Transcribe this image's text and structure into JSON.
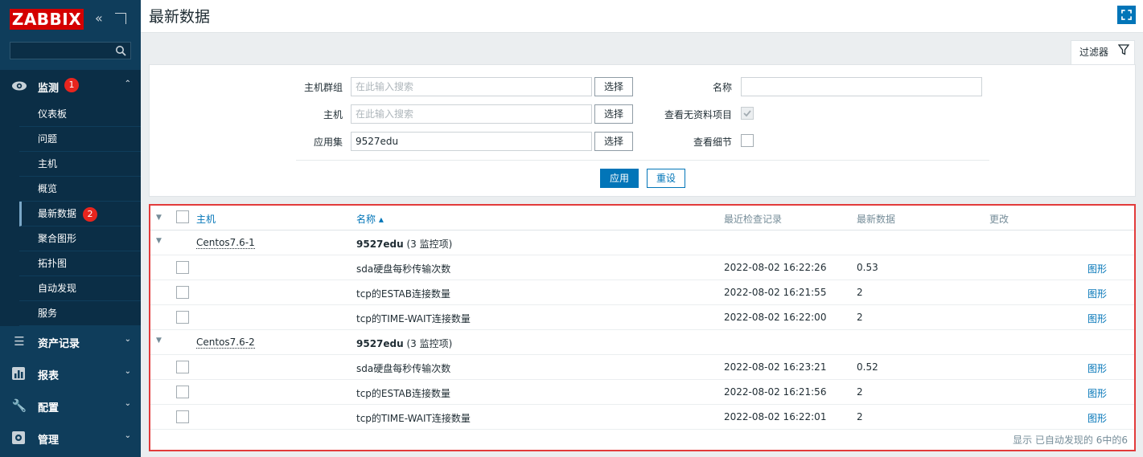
{
  "sidebar": {
    "logo": "ZABBIX",
    "search": {
      "value": "",
      "placeholder": ""
    },
    "monitoring": {
      "label": "监测",
      "badge": "1"
    },
    "monitoring_items": [
      {
        "label": "仪表板"
      },
      {
        "label": "问题"
      },
      {
        "label": "主机"
      },
      {
        "label": "概览"
      },
      {
        "label": "最新数据",
        "badge": "2"
      },
      {
        "label": "聚合图形"
      },
      {
        "label": "拓扑图"
      },
      {
        "label": "自动发现"
      },
      {
        "label": "服务"
      }
    ],
    "menus": [
      {
        "label": "资产记录",
        "icon": "list-icon"
      },
      {
        "label": "报表",
        "icon": "bar-chart-icon"
      },
      {
        "label": "配置",
        "icon": "wrench-icon"
      },
      {
        "label": "管理",
        "icon": "gear-icon"
      }
    ]
  },
  "header": {
    "title": "最新数据"
  },
  "filter": {
    "tab_label": "过滤器",
    "host_group_label": "主机群组",
    "host_group_placeholder": "在此输入搜索",
    "host_label": "主机",
    "host_placeholder": "在此输入搜索",
    "application_label": "应用集",
    "application_value": "9527edu",
    "select_label": "选择",
    "name_label": "名称",
    "name_value": "",
    "show_without_data_label": "查看无资料项目",
    "show_without_data_checked": true,
    "show_details_label": "查看细节",
    "show_details_checked": false,
    "apply_label": "应用",
    "reset_label": "重设"
  },
  "table": {
    "headers": {
      "host": "主机",
      "name": "名称 ▴",
      "last_check": "最近检查记录",
      "last_value": "最新数据",
      "change": "更改"
    },
    "groups": [
      {
        "host": "Centos7.6-1",
        "application": "9527edu",
        "count": "(3 监控项)",
        "items": [
          {
            "name": "sda硬盘每秒传输次数",
            "last_check": "2022-08-02 16:22:26",
            "last_value": "0.53",
            "link": "图形"
          },
          {
            "name": "tcp的ESTAB连接数量",
            "last_check": "2022-08-02 16:21:55",
            "last_value": "2",
            "link": "图形"
          },
          {
            "name": "tcp的TIME-WAIT连接数量",
            "last_check": "2022-08-02 16:22:00",
            "last_value": "2",
            "link": "图形"
          }
        ]
      },
      {
        "host": "Centos7.6-2",
        "application": "9527edu",
        "count": "(3 监控项)",
        "items": [
          {
            "name": "sda硬盘每秒传输次数",
            "last_check": "2022-08-02 16:23:21",
            "last_value": "0.52",
            "link": "图形"
          },
          {
            "name": "tcp的ESTAB连接数量",
            "last_check": "2022-08-02 16:21:56",
            "last_value": "2",
            "link": "图形"
          },
          {
            "name": "tcp的TIME-WAIT连接数量",
            "last_check": "2022-08-02 16:22:01",
            "last_value": "2",
            "link": "图形"
          }
        ]
      }
    ],
    "footer": "显示 已自动发现的 6中的6"
  },
  "colors": {
    "sidebar": "#0f3d5b",
    "accent": "#0275b8",
    "badge": "#e8251e",
    "logo": "#d40000",
    "highlight_border": "#e23b3b"
  }
}
